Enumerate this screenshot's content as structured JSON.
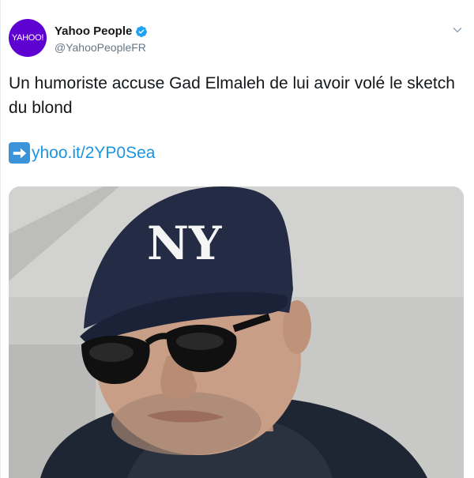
{
  "tweet": {
    "avatar_text": "YAHOO!",
    "display_name": "Yahoo People",
    "handle": "@YahooPeopleFR",
    "text": "Un humoriste accuse Gad Elmaleh de lui avoir volé le sketch du blond",
    "link_icon": "right-arrow-emoji-icon",
    "link_text": "yhoo.it/2YP0Sea",
    "verified_icon": "verified-badge-icon",
    "more_icon": "chevron-down-icon"
  },
  "colors": {
    "avatar_bg": "#5f01d1",
    "link": "#1b95e0",
    "verified": "#1da1f2",
    "handle": "#657786",
    "text": "#14171a"
  },
  "media": {
    "cap_logo": "NY"
  }
}
